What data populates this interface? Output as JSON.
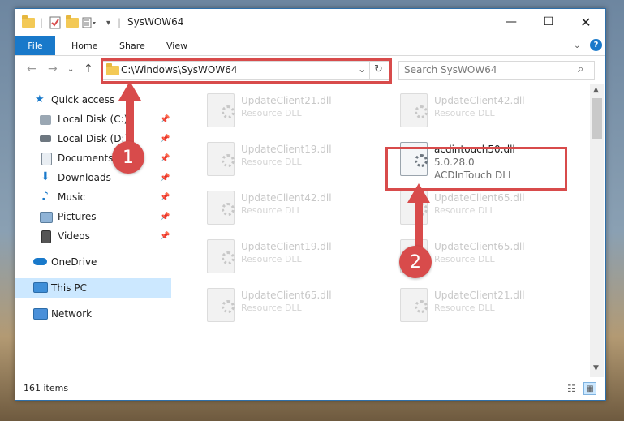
{
  "window": {
    "title": "SysWOW64"
  },
  "ribbon": {
    "tabs": [
      "File",
      "Home",
      "Share",
      "View"
    ]
  },
  "address": {
    "path": "C:\\Windows\\SysWOW64",
    "search_placeholder": "Search SysWOW64"
  },
  "nav": {
    "items": [
      {
        "label": "Quick access"
      },
      {
        "label": "Local Disk (C:)"
      },
      {
        "label": "Local Disk (D:)"
      },
      {
        "label": "Documents"
      },
      {
        "label": "Downloads"
      },
      {
        "label": "Music"
      },
      {
        "label": "Pictures"
      },
      {
        "label": "Videos"
      },
      {
        "label": "OneDrive"
      },
      {
        "label": "This PC"
      },
      {
        "label": "Network"
      }
    ]
  },
  "files": {
    "col1": [
      {
        "name": "UpdateClient21.dll",
        "type": "Resource DLL"
      },
      {
        "name": "UpdateClient19.dll",
        "type": "Resource DLL"
      },
      {
        "name": "UpdateClient42.dll",
        "type": "Resource DLL"
      },
      {
        "name": "UpdateClient19.dll",
        "type": "Resource DLL"
      },
      {
        "name": "UpdateClient65.dll",
        "type": "Resource DLL"
      }
    ],
    "col2": [
      {
        "name": "UpdateClient42.dll",
        "type": "Resource DLL"
      },
      {
        "name": "UpdateClient65.dll",
        "type": "Resource DLL"
      },
      {
        "name": "UpdateClient65.dll",
        "type": "Resource DLL"
      },
      {
        "name": "UpdateClient21.dll",
        "type": "Resource DLL"
      }
    ],
    "highlight": {
      "name": "acdintouch50.dll",
      "version": "5.0.28.0",
      "type": "ACDInTouch DLL"
    }
  },
  "status": {
    "count": "161 items"
  },
  "annotations": {
    "step1": "1",
    "step2": "2"
  },
  "colors": {
    "accent": "#1979ca",
    "highlight_red": "#d84b4b"
  }
}
